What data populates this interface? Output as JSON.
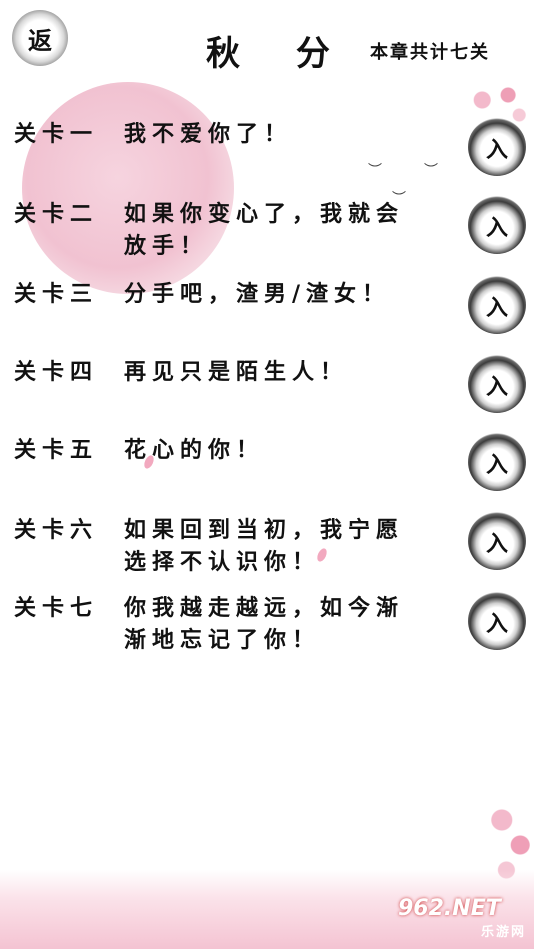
{
  "header": {
    "back_label": "返",
    "title": "秋 分",
    "chapter_total": "本章共计七关"
  },
  "levels": [
    {
      "label": "关卡一",
      "name": "我不爱你了！",
      "button": "入"
    },
    {
      "label": "关卡二",
      "name": "如果你变心了，我就会放手！",
      "button": "入"
    },
    {
      "label": "关卡三",
      "name": "分手吧，渣男/渣女！",
      "button": "入"
    },
    {
      "label": "关卡四",
      "name": "再见只是陌生人！",
      "button": "入"
    },
    {
      "label": "关卡五",
      "name": "花心的你！",
      "button": "入"
    },
    {
      "label": "关卡六",
      "name": "如果回到当初，我宁愿选择不认识你！",
      "button": "入"
    },
    {
      "label": "关卡七",
      "name": "你我越走越远，如今渐渐地忘记了你！",
      "button": "入"
    }
  ],
  "watermark": {
    "top": "962.NET",
    "bottom": "乐游网"
  }
}
